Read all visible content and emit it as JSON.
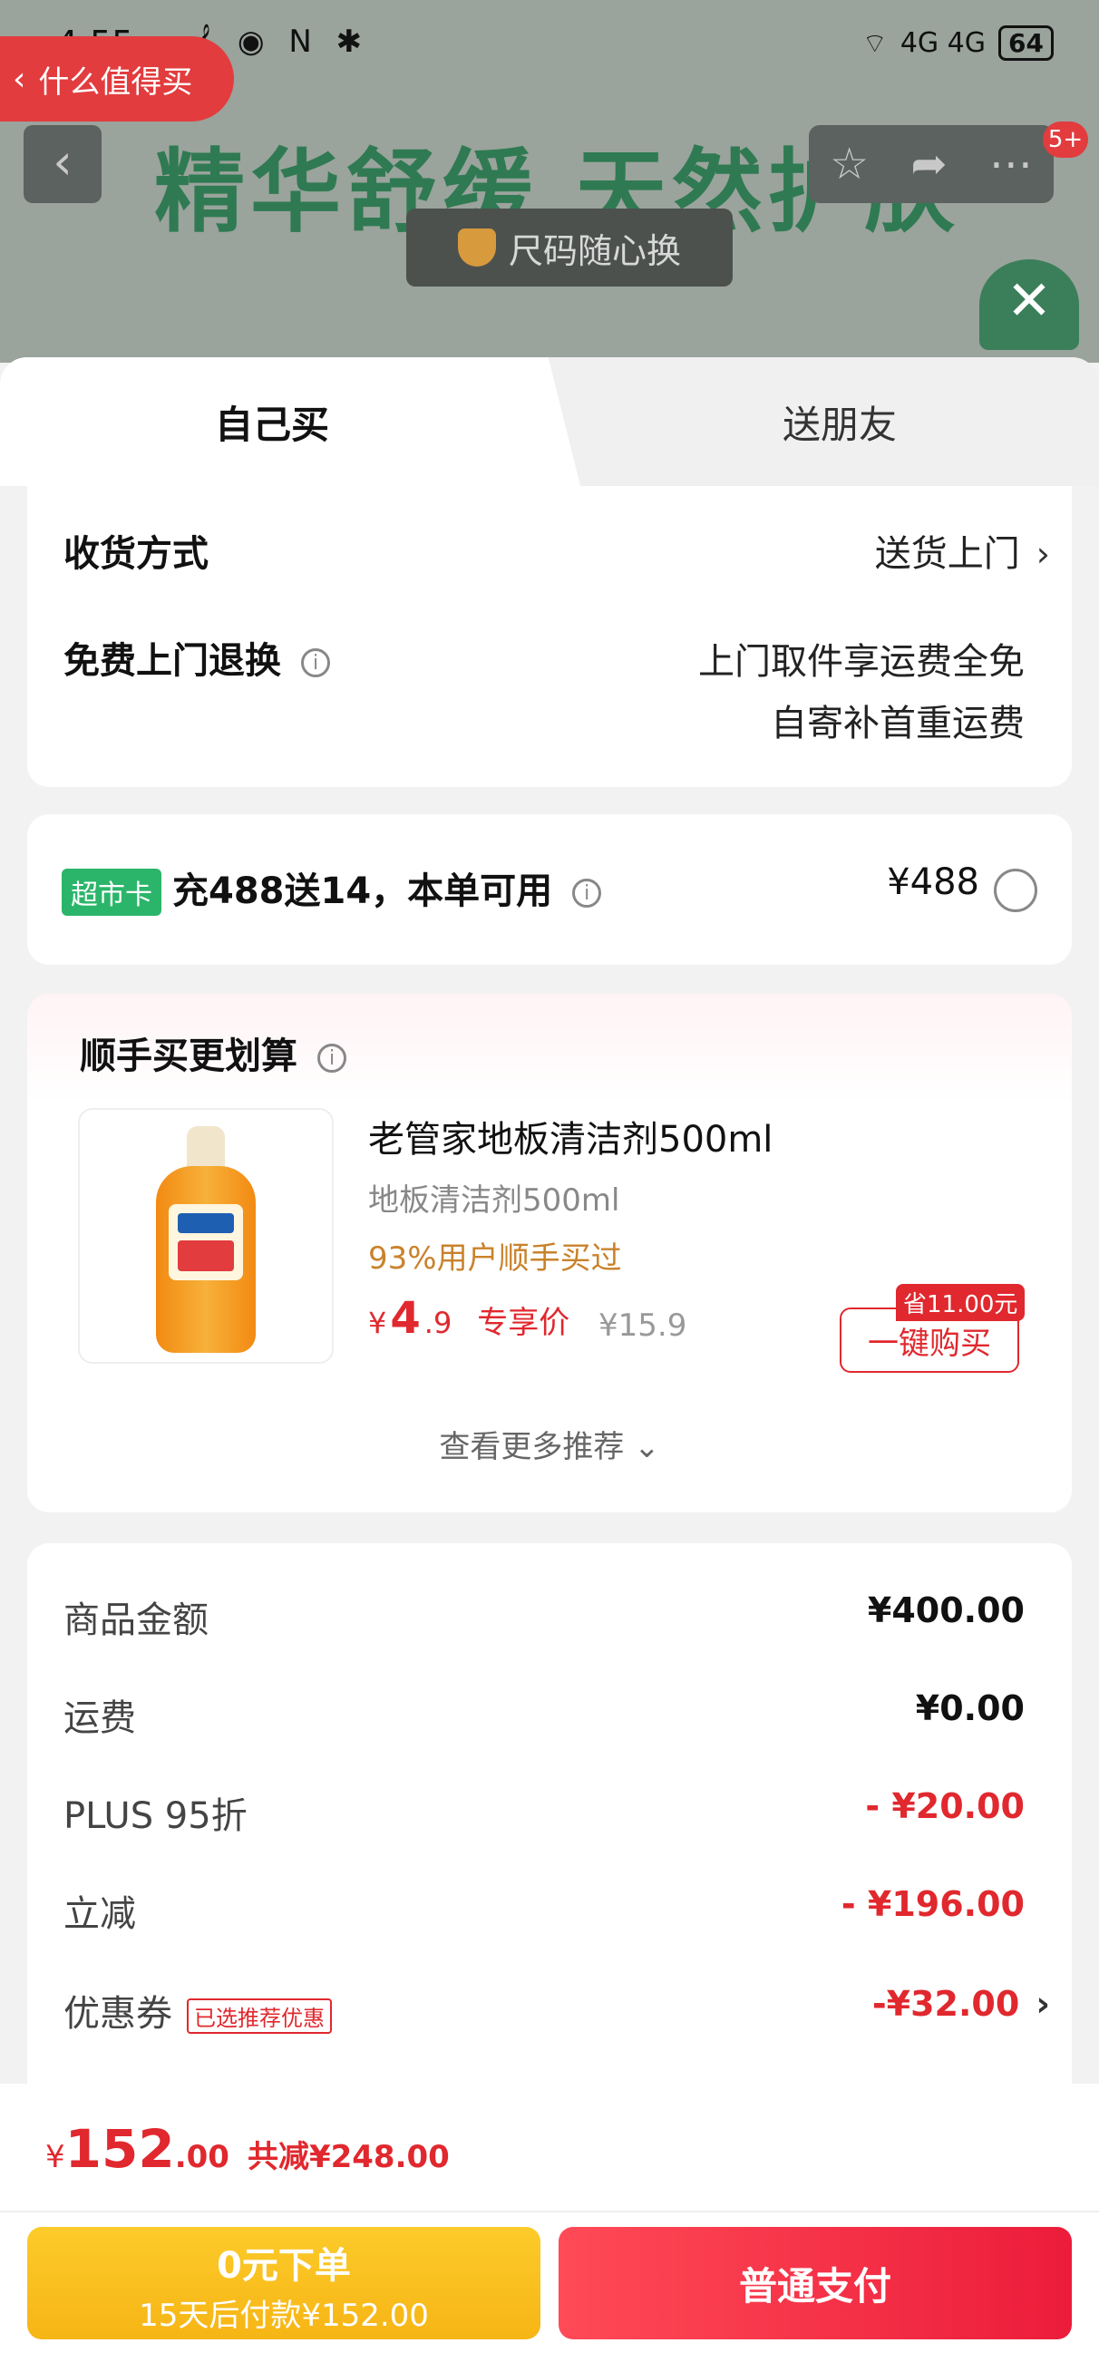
{
  "status_bar": {
    "time": "4:55",
    "icons_left": "𝄞 ◉ N ✱",
    "signal": "4G 4G",
    "battery": "64"
  },
  "back_app": {
    "label": "什么值得买"
  },
  "background_page": {
    "banner_text": "精华舒缓 天然护肤",
    "chip_text": "尺码随心换",
    "notification_badge": "5+"
  },
  "tabs": {
    "self_buy": "自己买",
    "gift_friend": "送朋友"
  },
  "delivery": {
    "method_label": "收货方式",
    "method_value": "送货上门",
    "return_label": "免费上门退换",
    "return_value_line1": "上门取件享运费全免",
    "return_value_line2": "自寄补首重运费"
  },
  "market_card": {
    "tag": "超市卡",
    "text": "充488送14，本单可用",
    "price": "¥488"
  },
  "recommendation": {
    "title": "顺手买更划算",
    "product": {
      "name": "老管家地板清洁剂500ml",
      "subtitle": "地板清洁剂500ml",
      "tip": "93%用户顺手买过",
      "price_symbol": "¥",
      "price_int": "4",
      "price_dec": ".9",
      "exclusive_label": "专享价",
      "original_price": "¥15.9",
      "save_badge": "省11.00元",
      "buy_button": "一键购买"
    },
    "more_label": "查看更多推荐 ⌄"
  },
  "bill": {
    "rows": [
      {
        "label": "商品金额",
        "value": "¥400.00"
      },
      {
        "label": "运费",
        "value": "¥0.00"
      },
      {
        "label": "PLUS 95折",
        "value": "- ¥20.00"
      },
      {
        "label": "立减",
        "value": "- ¥196.00"
      },
      {
        "label": "优惠券",
        "value": "-¥32.00"
      }
    ],
    "coupon_tag": "已选推荐优惠"
  },
  "footer": {
    "total_symbol": "¥",
    "total_int": "152",
    "total_dec": ".00",
    "total_cut": "共减¥248.00",
    "later_pay_title": "0元下单",
    "later_pay_sub": "15天后付款¥152.00",
    "pay_button": "普通支付"
  },
  "colors": {
    "accent_red": "#e0282e",
    "market_green": "#2bb56a",
    "later_yellow": "#f6b515"
  }
}
